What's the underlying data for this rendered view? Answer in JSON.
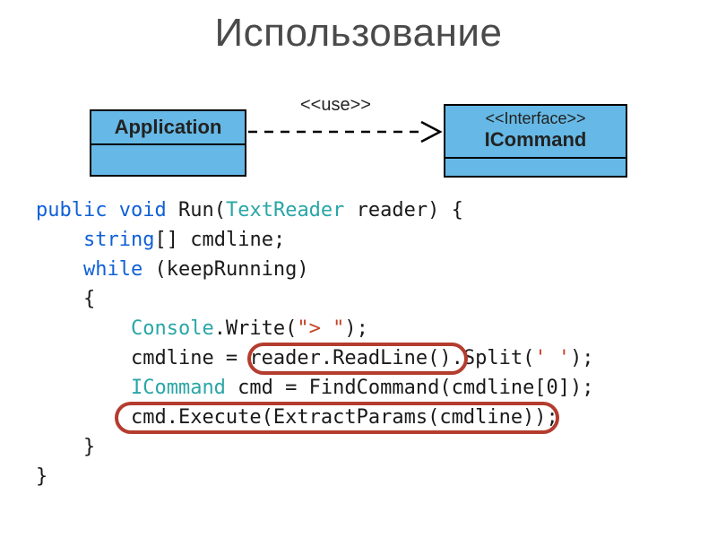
{
  "title": "Использование",
  "uml": {
    "application_label": "Application",
    "use_label": "<<use>>",
    "interface_stereotype": "<<Interface>>",
    "interface_name": "ICommand"
  },
  "code": {
    "kw_public": "public",
    "kw_void": "void",
    "fn_run": "Run",
    "type_textreader": "TextReader",
    "param_reader": "reader",
    "brace_open": "{",
    "kw_string": "string",
    "arr_brackets": "[]",
    "var_cmdline": "cmdline",
    "semicolon": ";",
    "kw_while": "while",
    "cond_keeprunning": "(keepRunning)",
    "type_console": "Console",
    "write_call": ".Write(",
    "str_prompt": "\"> \"",
    "close_paren_semi": ");",
    "assign_cmdline": "cmdline = ",
    "reader_readline": "reader.ReadLine()",
    "split_open": ".Split(",
    "chr_space": "' '",
    "type_icommand": "ICommand",
    "cmd_assign": " cmd = FindCommand(cmdline[0]);",
    "execute_line": "cmd.Execute(ExtractParams(cmdline));",
    "brace_close": "}"
  }
}
